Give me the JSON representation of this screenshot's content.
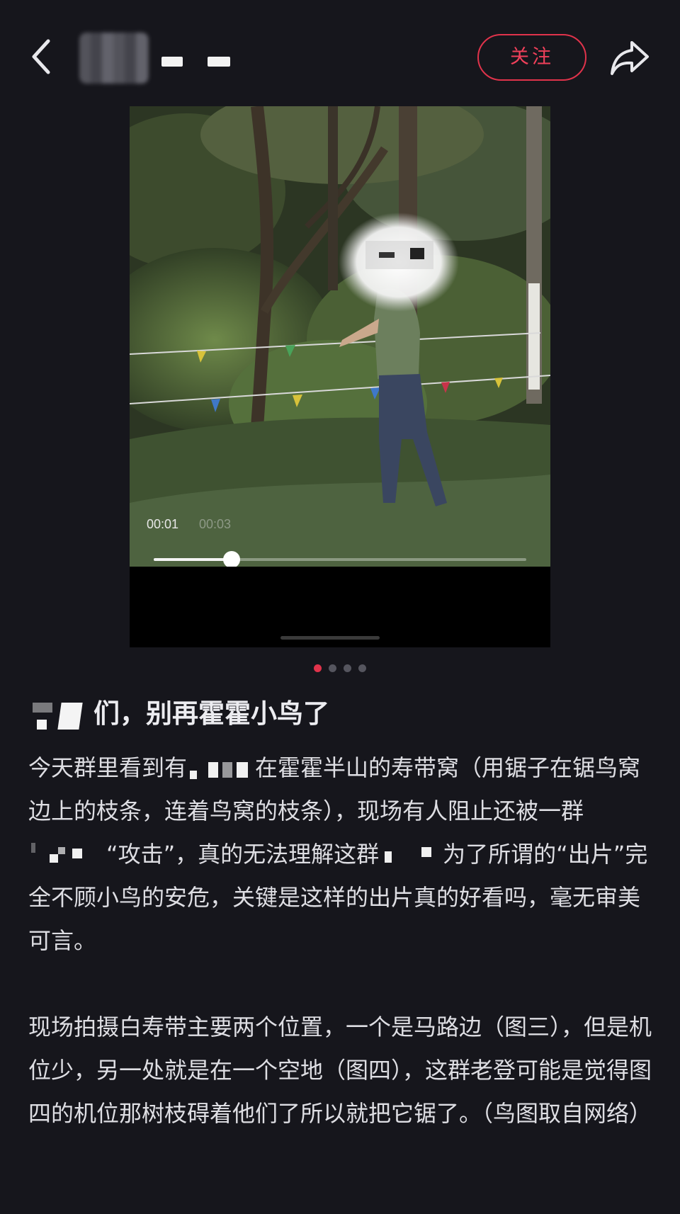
{
  "header": {
    "back_icon": "chevron-left-icon",
    "follow_label": "关注",
    "share_icon": "share-arrow-icon",
    "accent_color": "#e0334b"
  },
  "media": {
    "current_time": "00:01",
    "total_time": "00:03",
    "progress": 0.21,
    "pages": 4,
    "active_page": 1
  },
  "post": {
    "title_text": "们，别再霍霍小鸟了",
    "paragraph1": {
      "part1": "今天群里看到有",
      "part2": "在霍霍半山的寿带窝（用锯子在锯鸟窝边上的枝条，连着鸟窝的枝条），现场有人阻止还被一群",
      "part3": "“攻击”，真的无法理解这群",
      "part4": "为了所谓的“出片”完全不顾小鸟的安危，关键是这样的出片真的好看吗，毫无审美可言。"
    },
    "paragraph2": "现场拍摄白寿带主要两个位置，一个是马路边（图三），但是机位少，另一处就是在一个空地（图四），这群老登可能是觉得图四的机位那树枝碍着他们了所以就把它锯了。（鸟图取自网络）"
  }
}
